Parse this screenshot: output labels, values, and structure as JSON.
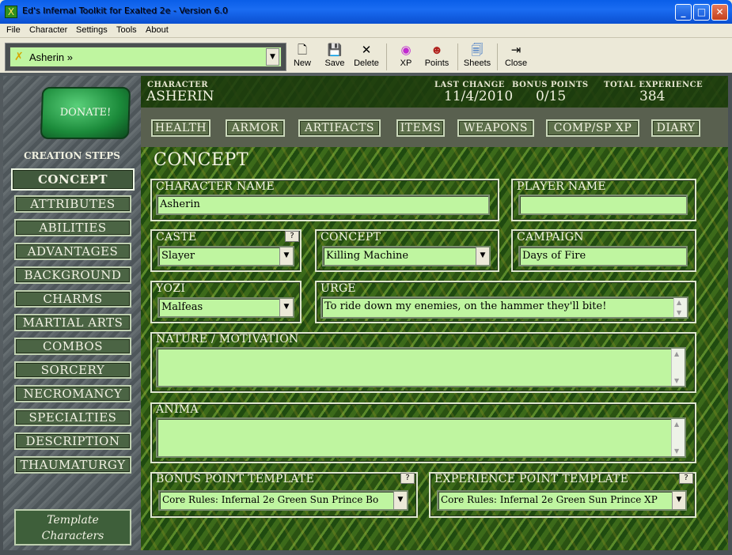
{
  "window": {
    "title": "Ed's Infernal Toolkit for Exalted 2e - Version 6.0",
    "minimize": "_",
    "maximize": "□",
    "close": "✕",
    "icon": "X"
  },
  "menu": [
    "File",
    "Character",
    "Settings",
    "Tools",
    "About"
  ],
  "toolbar": {
    "character_selected": "Asherin »",
    "buttons": [
      {
        "label": "New",
        "icon": "new-document-icon",
        "glyph": "🗋"
      },
      {
        "label": "Save",
        "icon": "floppy-disk-icon",
        "glyph": "💾"
      },
      {
        "label": "Delete",
        "icon": "delete-x-icon",
        "glyph": "✕"
      },
      {
        "label": "XP",
        "icon": "xp-swirl-icon",
        "glyph": "◉"
      },
      {
        "label": "Points",
        "icon": "points-figure-icon",
        "glyph": "☻"
      },
      {
        "label": "Sheets",
        "icon": "sheets-magnifier-icon",
        "glyph": "🗐"
      },
      {
        "label": "Close",
        "icon": "close-door-icon",
        "glyph": "⇥"
      }
    ]
  },
  "header": {
    "character_label": "CHARACTER",
    "character_name": "ASHERIN",
    "last_change_label": "LAST CHANGE",
    "last_change": "11/4/2010",
    "bonus_points_label": "BONUS POINTS",
    "bonus_points": "0/15",
    "total_xp_label": "TOTAL EXPERIENCE",
    "total_xp": "384"
  },
  "nav": [
    "HEALTH",
    "ARMOR",
    "ARTIFACTS",
    "ITEMS",
    "WEAPONS",
    "COMP/SP XP",
    "DIARY"
  ],
  "sidebar": {
    "donate": "DONATE!",
    "creation_title": "CREATION STEPS",
    "steps": [
      "CONCEPT",
      "ATTRIBUTES",
      "ABILITIES",
      "ADVANTAGES",
      "BACKGROUND",
      "CHARMS",
      "MARTIAL ARTS",
      "COMBOS",
      "SORCERY",
      "NECROMANCY",
      "SPECIALTIES",
      "DESCRIPTION",
      "THAUMATURGY"
    ],
    "active_step": "CONCEPT",
    "template_line1": "Template",
    "template_line2": "Characters"
  },
  "concept": {
    "title": "CONCEPT",
    "character_name_label": "CHARACTER NAME",
    "character_name": "Asherin",
    "player_name_label": "PLAYER NAME",
    "player_name": "",
    "caste_label": "CASTE",
    "caste": "Slayer",
    "concept_label": "CONCEPT",
    "concept": "Killing Machine",
    "campaign_label": "CAMPAIGN",
    "campaign": "Days of Fire",
    "yozi_label": "YOZI",
    "yozi": "Malfeas",
    "urge_label": "URGE",
    "urge": "To ride down my enemies, on the hammer they'll bite!",
    "nature_label": "NATURE / MOTIVATION",
    "nature": "",
    "anima_label": "ANIMA",
    "anima": "",
    "bonus_template_label": "BONUS POINT TEMPLATE",
    "bonus_template": "Core Rules: Infernal 2e Green Sun Prince Bo",
    "xp_template_label": "EXPERIENCE POINT TEMPLATE",
    "xp_template": "Core Rules: Infernal 2e Green Sun Prince XP",
    "help": "?"
  },
  "colors": {
    "field_bg": "#bff5a0",
    "titlebar": "#0a5ee8"
  }
}
